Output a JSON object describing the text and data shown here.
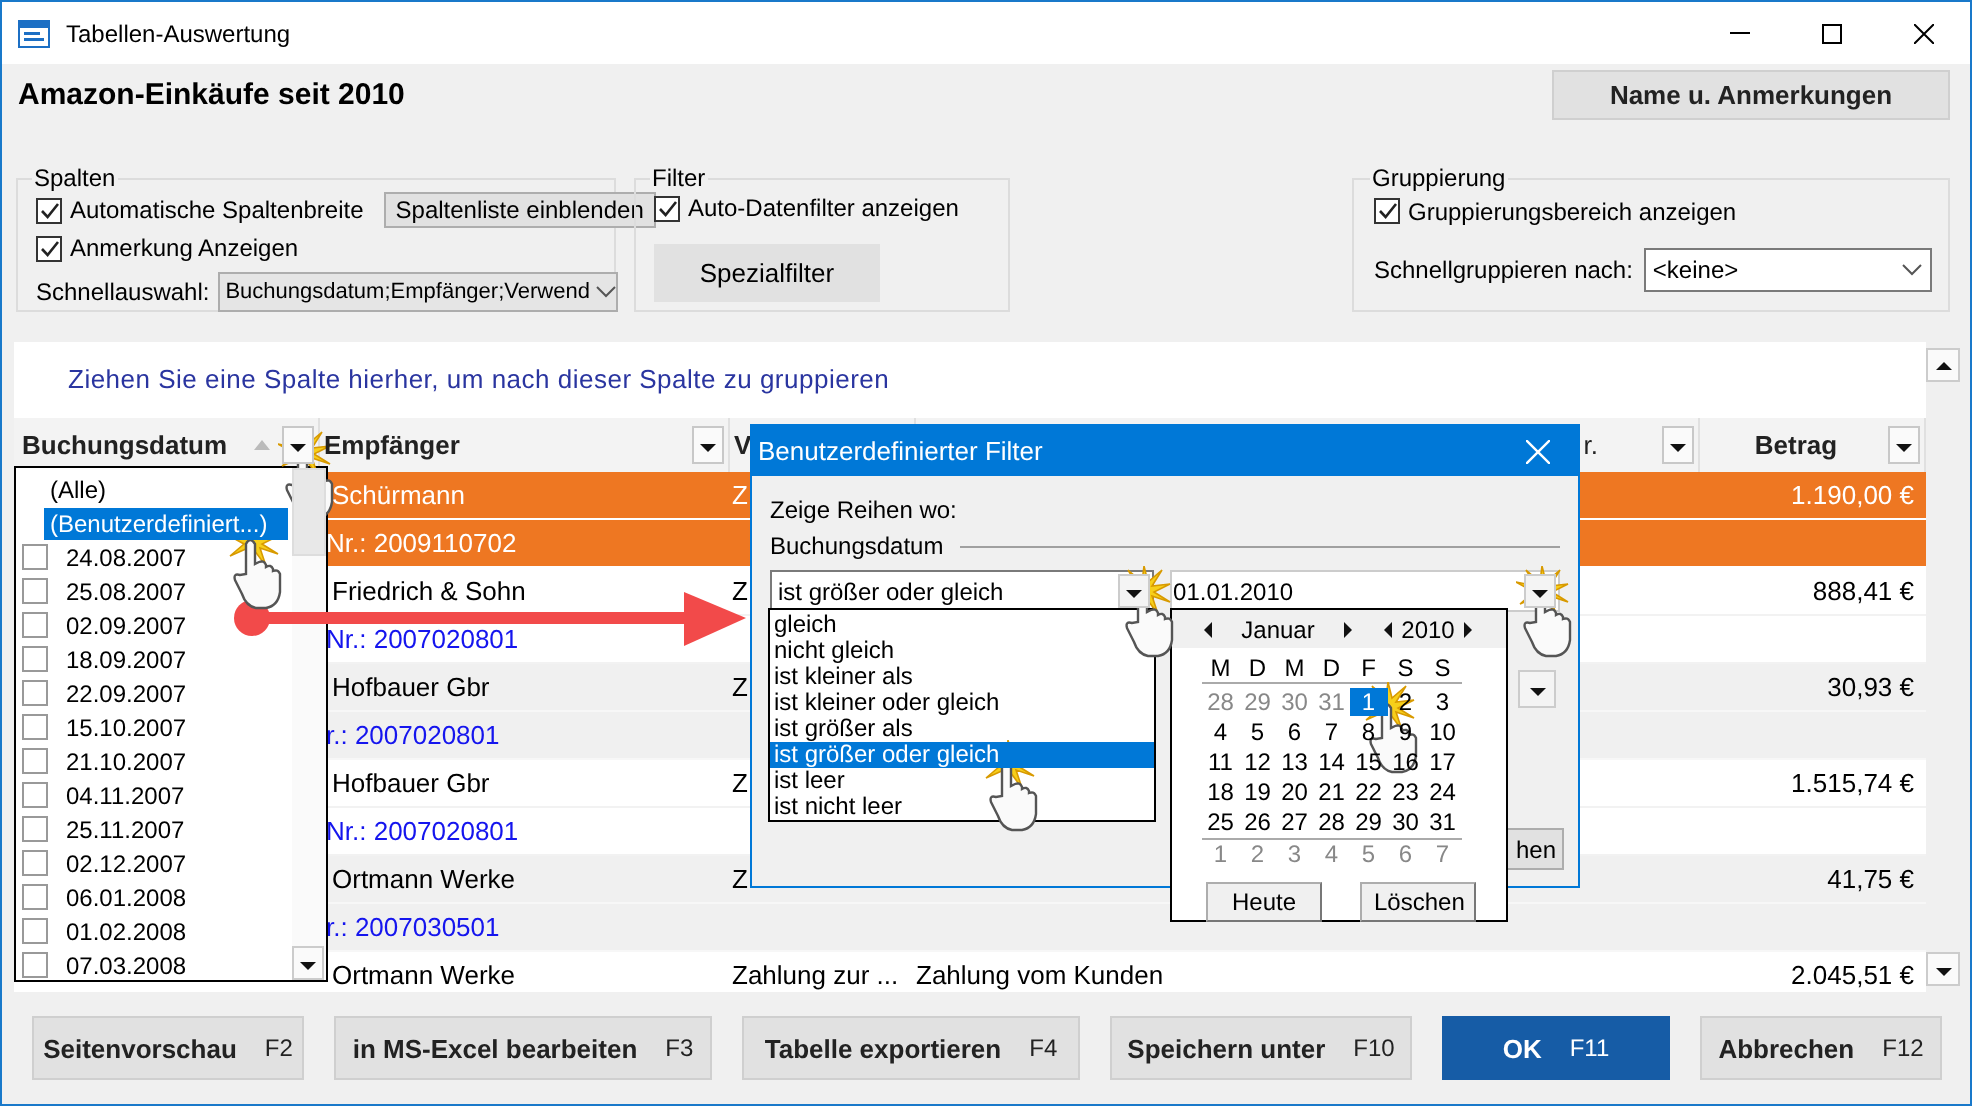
{
  "window": {
    "title": "Tabellen-Auswertung"
  },
  "header": {
    "title": "Amazon-Einkäufe seit 2010",
    "button": "Name u. Anmerkungen"
  },
  "spalten": {
    "title": "Spalten",
    "auto_width": {
      "label": "Automatische Spaltenbreite",
      "checked": true
    },
    "list_button": "Spaltenliste einblenden",
    "show_notes": {
      "label": "Anmerkung Anzeigen",
      "checked": true
    },
    "quick_select": {
      "label": "Schnellauswahl:",
      "value": "Buchungsdatum;Empfänger;Verwend"
    }
  },
  "filter": {
    "title": "Filter",
    "auto_filter": {
      "label": "Auto-Datenfilter anzeigen",
      "checked": true
    },
    "special_button": "Spezialfilter"
  },
  "gruppierung": {
    "title": "Gruppierung",
    "show_area": {
      "label": "Gruppierungsbereich anzeigen",
      "checked": true
    },
    "quick_group": {
      "label": "Schnellgruppieren nach:",
      "value": "<keine>"
    }
  },
  "table": {
    "group_hint": "Ziehen Sie eine Spalte hierher, um nach dieser Spalte zu gruppieren",
    "columns": [
      {
        "label": "Buchungsdatum",
        "sorted": true
      },
      {
        "label": "Empfänger",
        "sorted": false
      },
      {
        "label": "V",
        "sorted": false
      },
      {
        "label": "r.",
        "sorted": false
      },
      {
        "label": "Betrag",
        "sorted": false
      }
    ],
    "records": [
      {
        "recipient": "Schürmann",
        "column_3": "Z",
        "amount": "1.190,00 €",
        "number": "Nr.: 2009110702",
        "selected": true
      },
      {
        "recipient": "Friedrich & Sohn",
        "column_3": "Z",
        "amount": "888,41 €",
        "number": "Nr.: 2007020801",
        "selected": false
      },
      {
        "recipient": "Hofbauer Gbr",
        "column_3": "Z",
        "amount": "30,93 €",
        "number": "r.: 2007020801",
        "selected": false
      },
      {
        "recipient": "Hofbauer Gbr",
        "column_3": "Z",
        "amount": "1.515,74 €",
        "number": "Nr.: 2007020801",
        "selected": false
      },
      {
        "recipient": "Ortmann Werke",
        "column_3": "Z",
        "amount": "41,75 €",
        "number": "r.: 2007030501",
        "selected": false
      },
      {
        "recipient": "Ortmann Werke",
        "column_3": "Zahlung zur ...",
        "column_4": "Zahlung vom Kunden",
        "amount": "2.045,51 €",
        "selected": false
      }
    ]
  },
  "date_list": {
    "items": [
      {
        "label": "(Alle)",
        "kind": "special",
        "selected": false
      },
      {
        "label": "(Benutzerdefiniert...)",
        "kind": "special",
        "selected": true
      },
      {
        "label": "24.08.2007",
        "kind": "check",
        "checked": false,
        "selected": false
      },
      {
        "label": "25.08.2007",
        "kind": "check",
        "checked": false,
        "selected": false
      },
      {
        "label": "02.09.2007",
        "kind": "check",
        "checked": false,
        "selected": false
      },
      {
        "label": "18.09.2007",
        "kind": "check",
        "checked": false,
        "selected": false
      },
      {
        "label": "22.09.2007",
        "kind": "check",
        "checked": false,
        "selected": false
      },
      {
        "label": "15.10.2007",
        "kind": "check",
        "checked": false,
        "selected": false
      },
      {
        "label": "21.10.2007",
        "kind": "check",
        "checked": false,
        "selected": false
      },
      {
        "label": "04.11.2007",
        "kind": "check",
        "checked": false,
        "selected": false
      },
      {
        "label": "25.11.2007",
        "kind": "check",
        "checked": false,
        "selected": false
      },
      {
        "label": "02.12.2007",
        "kind": "check",
        "checked": false,
        "selected": false
      },
      {
        "label": "06.01.2008",
        "kind": "check",
        "checked": false,
        "selected": false
      },
      {
        "label": "01.02.2008",
        "kind": "check",
        "checked": false,
        "selected": false
      },
      {
        "label": "07.03.2008",
        "kind": "check",
        "checked": false,
        "selected": false
      }
    ]
  },
  "filter_dialog": {
    "title": "Benutzerdefinierter Filter",
    "prompt": "Zeige Reihen wo:",
    "field": "Buchungsdatum",
    "operator": "ist größer oder gleich",
    "operators": [
      {
        "label": "gleich",
        "selected": false
      },
      {
        "label": "nicht gleich",
        "selected": false
      },
      {
        "label": "ist kleiner als",
        "selected": false
      },
      {
        "label": "ist kleiner oder gleich",
        "selected": false
      },
      {
        "label": "ist größer als",
        "selected": false
      },
      {
        "label": "ist größer oder gleich",
        "selected": true
      },
      {
        "label": "ist leer",
        "selected": false
      },
      {
        "label": "ist nicht leer",
        "selected": false
      }
    ],
    "date": "01.01.2010",
    "partial_button": "hen"
  },
  "calendar": {
    "month": "Januar",
    "year": "2010",
    "weekdays": [
      "M",
      "D",
      "M",
      "D",
      "F",
      "S",
      "S"
    ],
    "weeks": [
      [
        {
          "day": "28",
          "other_month": true,
          "selected": false
        },
        {
          "day": "29",
          "other_month": true,
          "selected": false
        },
        {
          "day": "30",
          "other_month": true,
          "selected": false
        },
        {
          "day": "31",
          "other_month": true,
          "selected": false
        },
        {
          "day": "1",
          "other_month": false,
          "selected": true
        },
        {
          "day": "2",
          "other_month": false,
          "selected": false
        },
        {
          "day": "3",
          "other_month": false,
          "selected": false
        }
      ],
      [
        {
          "day": "4",
          "other_month": false,
          "selected": false
        },
        {
          "day": "5",
          "other_month": false,
          "selected": false
        },
        {
          "day": "6",
          "other_month": false,
          "selected": false
        },
        {
          "day": "7",
          "other_month": false,
          "selected": false
        },
        {
          "day": "8",
          "other_month": false,
          "selected": false
        },
        {
          "day": "9",
          "other_month": false,
          "selected": false
        },
        {
          "day": "10",
          "other_month": false,
          "selected": false
        }
      ],
      [
        {
          "day": "11",
          "other_month": false,
          "selected": false
        },
        {
          "day": "12",
          "other_month": false,
          "selected": false
        },
        {
          "day": "13",
          "other_month": false,
          "selected": false
        },
        {
          "day": "14",
          "other_month": false,
          "selected": false
        },
        {
          "day": "15",
          "other_month": false,
          "selected": false
        },
        {
          "day": "16",
          "other_month": false,
          "selected": false
        },
        {
          "day": "17",
          "other_month": false,
          "selected": false
        }
      ],
      [
        {
          "day": "18",
          "other_month": false,
          "selected": false
        },
        {
          "day": "19",
          "other_month": false,
          "selected": false
        },
        {
          "day": "20",
          "other_month": false,
          "selected": false
        },
        {
          "day": "21",
          "other_month": false,
          "selected": false
        },
        {
          "day": "22",
          "other_month": false,
          "selected": false
        },
        {
          "day": "23",
          "other_month": false,
          "selected": false
        },
        {
          "day": "24",
          "other_month": false,
          "selected": false
        }
      ],
      [
        {
          "day": "25",
          "other_month": false,
          "selected": false
        },
        {
          "day": "26",
          "other_month": false,
          "selected": false
        },
        {
          "day": "27",
          "other_month": false,
          "selected": false
        },
        {
          "day": "28",
          "other_month": false,
          "selected": false
        },
        {
          "day": "29",
          "other_month": false,
          "selected": false
        },
        {
          "day": "30",
          "other_month": false,
          "selected": false
        },
        {
          "day": "31",
          "other_month": false,
          "selected": false
        }
      ],
      [
        {
          "day": "1",
          "other_month": true,
          "selected": false
        },
        {
          "day": "2",
          "other_month": true,
          "selected": false
        },
        {
          "day": "3",
          "other_month": true,
          "selected": false
        },
        {
          "day": "4",
          "other_month": true,
          "selected": false
        },
        {
          "day": "5",
          "other_month": true,
          "selected": false
        },
        {
          "day": "6",
          "other_month": true,
          "selected": false
        },
        {
          "day": "7",
          "other_month": true,
          "selected": false
        }
      ]
    ],
    "buttons": [
      "Heute",
      "Löschen"
    ]
  },
  "buttons": [
    {
      "label": "Seitenvorschau",
      "key": "F2",
      "kind": "normal"
    },
    {
      "label": "in MS-Excel bearbeiten",
      "key": "F3",
      "kind": "normal"
    },
    {
      "label": "Tabelle exportieren",
      "key": "F4",
      "kind": "normal"
    },
    {
      "label": "Speichern unter",
      "key": "F10",
      "kind": "normal"
    },
    {
      "label": "OK",
      "key": "F11",
      "kind": "default"
    },
    {
      "label": "Abbrechen",
      "key": "F12",
      "kind": "normal"
    }
  ]
}
